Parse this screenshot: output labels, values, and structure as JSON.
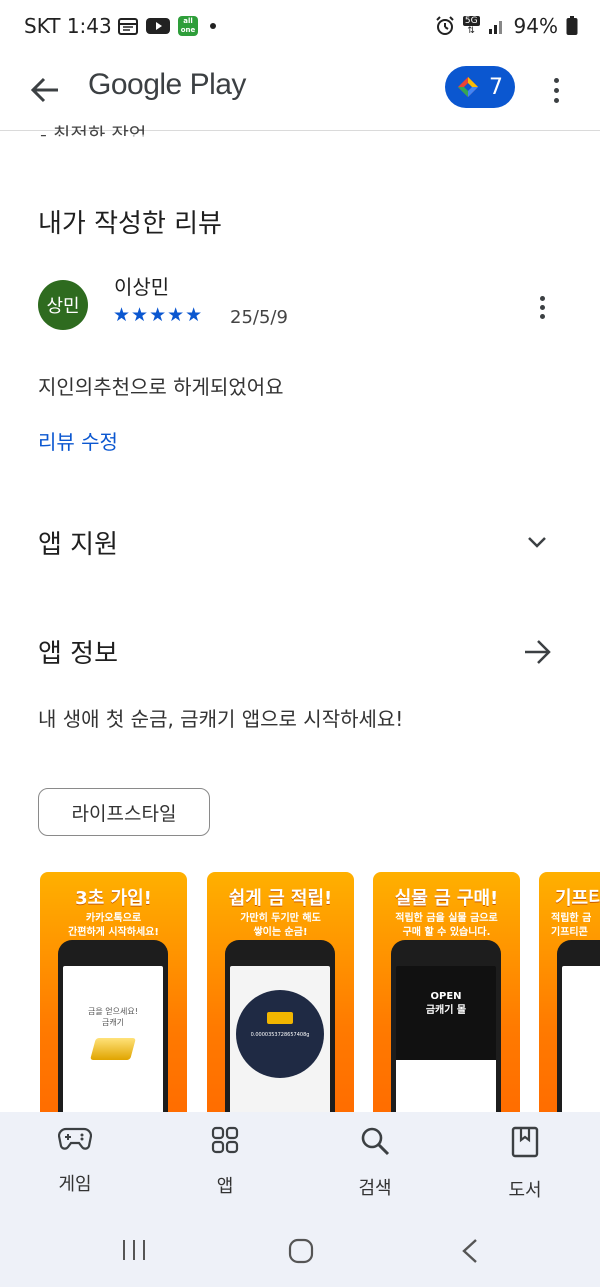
{
  "status_bar": {
    "carrier_time": "SKT 1:43",
    "network": "5G",
    "battery": "94%",
    "app_badge": "all one"
  },
  "app_bar": {
    "title": "Google Play",
    "points": "7"
  },
  "cut_off_text": "- 최적화 작업",
  "my_review": {
    "title": "내가 작성한 리뷰",
    "avatar_text": "상민",
    "reviewer": "이상민",
    "stars": "★★★★★",
    "date": "25/5/9",
    "text": "지인의추천으로 하게되었어요",
    "edit_label": "리뷰 수정"
  },
  "app_support": {
    "title": "앱 지원"
  },
  "app_info": {
    "title": "앱 정보",
    "description": "내 생애 첫 순금, 금캐기 앱으로 시작하세요!",
    "category": "라이프스타일"
  },
  "screenshots": [
    {
      "headline": "3초 가입!",
      "sub": "카카오톡으로\n간편하게 시작하세요!",
      "screen_text": "금을 얻으세요!\n금캐기"
    },
    {
      "headline": "쉽게 금 적립!",
      "sub": "가만히 두기만 해도\n쌓이는 순금!",
      "screen_value": "0.0000353728657408g"
    },
    {
      "headline": "실물 금 구매!",
      "sub": "적립한 금을 실물 금으로\n구매 할 수 있습니다.",
      "screen_text": "OPEN\n금캐기 몰"
    },
    {
      "headline": "기프티",
      "sub": "적립한 금\n기프티콘"
    }
  ],
  "bottom_nav": [
    {
      "label": "게임",
      "icon": "gamepad-icon"
    },
    {
      "label": "앱",
      "icon": "apps-grid-icon"
    },
    {
      "label": "검색",
      "icon": "search-icon"
    },
    {
      "label": "도서",
      "icon": "book-icon"
    }
  ],
  "colors": {
    "accent": "#0b57d0",
    "avatar": "#2e6b1f",
    "nav_bg": "#eef1f8",
    "shot_orange": "#ff8a00"
  }
}
